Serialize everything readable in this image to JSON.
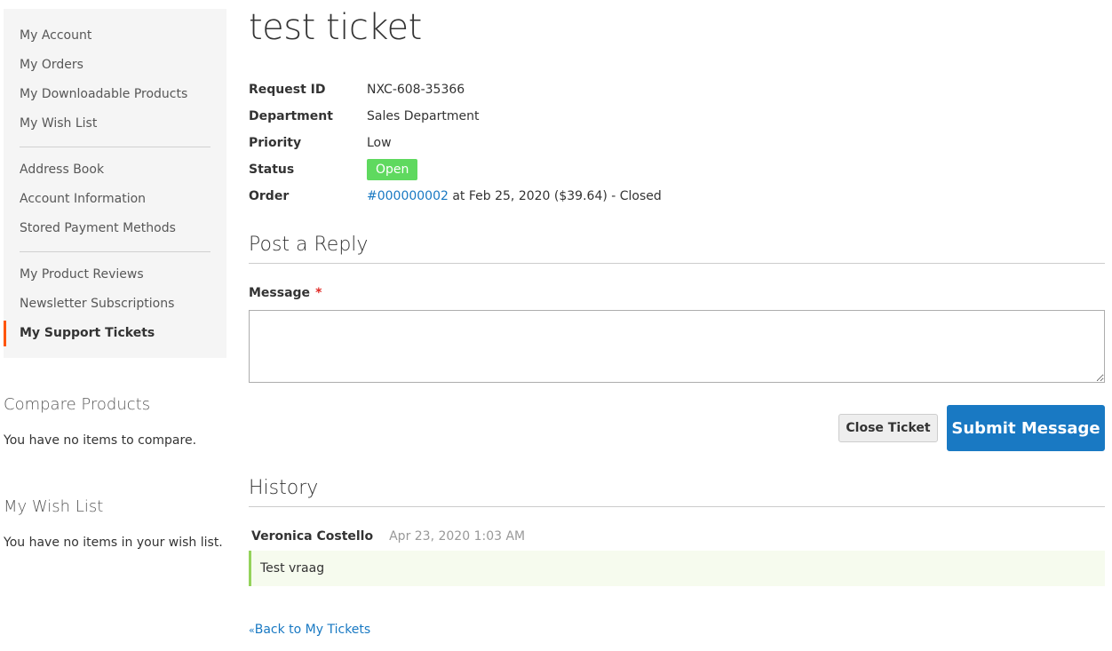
{
  "sidebar": {
    "groups": [
      [
        "My Account",
        "My Orders",
        "My Downloadable Products",
        "My Wish List"
      ],
      [
        "Address Book",
        "Account Information",
        "Stored Payment Methods"
      ],
      [
        "My Product Reviews",
        "Newsletter Subscriptions",
        "My Support Tickets"
      ]
    ],
    "active_item": "My Support Tickets",
    "compare": {
      "title": "Compare Products",
      "text": "You have no items to compare."
    },
    "wishlist": {
      "title": "My Wish List",
      "text": "You have no items in your wish list."
    }
  },
  "ticket": {
    "title": "test ticket",
    "request_id_label": "Request ID",
    "request_id": "NXC-608-35366",
    "department_label": "Department",
    "department": "Sales Department",
    "priority_label": "Priority",
    "priority": "Low",
    "status_label": "Status",
    "status": "Open",
    "order_label": "Order",
    "order_number": "#000000002",
    "order_details": " at Feb 25, 2020 ($39.64) - Closed"
  },
  "reply": {
    "section_title": "Post a Reply",
    "message_label": "Message",
    "required_mark": "*",
    "message_value": "",
    "close_button": "Close Ticket",
    "submit_button": "Submit Message"
  },
  "history": {
    "section_title": "History",
    "entries": [
      {
        "author": "Veronica Costello",
        "date": "Apr 23, 2020 1:03 AM",
        "message": "Test vraag"
      }
    ]
  },
  "back_link": {
    "arrow": "«",
    "label": "Back to My Tickets"
  },
  "colors": {
    "accent": "#1979c3",
    "active_marker": "#ff5501",
    "status_open": "#5fd95f",
    "history_border": "#94d35b"
  }
}
